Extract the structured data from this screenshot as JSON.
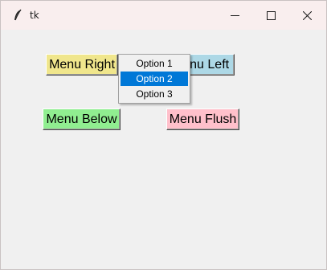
{
  "window": {
    "title": "tk",
    "icon": "feather-icon",
    "controls": {
      "minimize": "minimize-icon",
      "maximize": "maximize-icon",
      "close": "close-icon"
    }
  },
  "buttons": {
    "menu_right": {
      "label": "Menu Right",
      "color": "#f0e68c"
    },
    "menu_left": {
      "label": "Menu Left",
      "color": "#add8e6"
    },
    "menu_below": {
      "label": "Menu Below",
      "color": "#90ee90"
    },
    "menu_flush": {
      "label": "Menu Flush",
      "color": "#ffc0cb"
    }
  },
  "popup_menu": {
    "items": [
      {
        "label": "Option 1",
        "selected": false
      },
      {
        "label": "Option 2",
        "selected": true
      },
      {
        "label": "Option 3",
        "selected": false
      }
    ],
    "highlight_color": "#0078d7"
  }
}
